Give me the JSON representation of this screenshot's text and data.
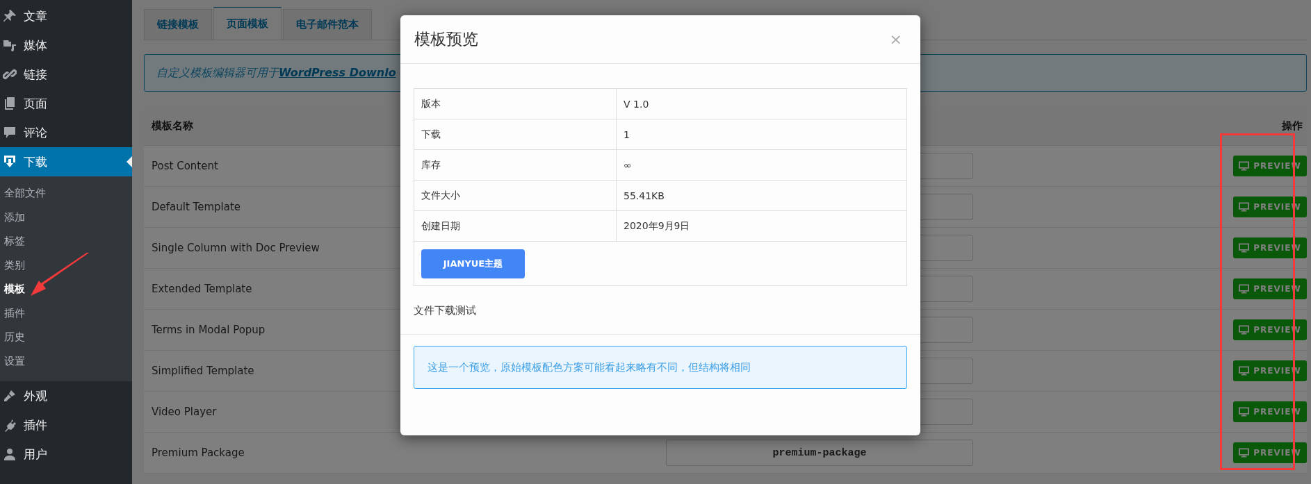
{
  "sidebar": {
    "items": [
      {
        "label": "文章",
        "selected": false
      },
      {
        "label": "媒体",
        "selected": false
      },
      {
        "label": "链接",
        "selected": false
      },
      {
        "label": "页面",
        "selected": false
      },
      {
        "label": "评论",
        "selected": false
      },
      {
        "label": "下载",
        "selected": true,
        "children": [
          {
            "label": "全部文件",
            "selected": false
          },
          {
            "label": "添加",
            "selected": false
          },
          {
            "label": "标签",
            "selected": false
          },
          {
            "label": "类别",
            "selected": false
          },
          {
            "label": "模板",
            "selected": true
          },
          {
            "label": "插件",
            "selected": false
          },
          {
            "label": "历史",
            "selected": false
          },
          {
            "label": "设置",
            "selected": false
          }
        ]
      },
      {
        "label": "外观",
        "selected": false
      },
      {
        "label": "插件",
        "selected": false
      },
      {
        "label": "用户",
        "selected": false
      }
    ]
  },
  "tabs": [
    {
      "label": "链接模板",
      "selected": false
    },
    {
      "label": "页面模板",
      "selected": true
    },
    {
      "label": "电子邮件范本",
      "selected": false
    }
  ],
  "notice": {
    "text": "自定义模板编辑器可用于",
    "link": "WordPress Downlo"
  },
  "table": {
    "columns": [
      "模板名称",
      "操作"
    ],
    "rows": [
      {
        "name": "Post Content",
        "button": "PREVIEW"
      },
      {
        "name": "Default Template",
        "button": "PREVIEW"
      },
      {
        "name": "Single Column with Doc Preview",
        "button": "PREVIEW"
      },
      {
        "name": "Extended Template",
        "button": "PREVIEW"
      },
      {
        "name": "Terms in Modal Popup",
        "button": "PREVIEW"
      },
      {
        "name": "Simplified Template",
        "button": "PREVIEW"
      },
      {
        "name": "Video Player",
        "button": "PREVIEW"
      },
      {
        "name": "Premium Package",
        "slug": "premium-package",
        "button": "PREVIEW"
      }
    ]
  },
  "modal": {
    "title": "模板预览",
    "close": "×",
    "details": [
      {
        "label": "版本",
        "value": "V 1.0"
      },
      {
        "label": "下载",
        "value": "1"
      },
      {
        "label": "库存",
        "value": "∞"
      },
      {
        "label": "文件大小",
        "value": "55.41KB"
      },
      {
        "label": "创建日期",
        "value": "2020年9月9日"
      }
    ],
    "button": "JIANYUE主题",
    "description": "文件下载测试",
    "alert": "这是一个预览，原始模板配色方案可能看起来略有不同，但结构将相同"
  },
  "annotations": [
    {
      "kind": "box"
    },
    {
      "kind": "arrow"
    }
  ]
}
